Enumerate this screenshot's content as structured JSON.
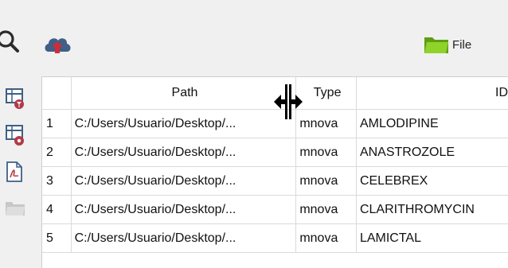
{
  "toolbar": {
    "search_icon": "search-icon",
    "upload_icon": "cloud-upload-icon",
    "file_icon": "folder-icon",
    "file_label": "File"
  },
  "sidebar": {
    "icons": [
      "table-filter-icon",
      "table-settings-icon",
      "pdf-document-icon",
      "folder-icon"
    ]
  },
  "table": {
    "columns": [
      "",
      "Path",
      "Type",
      "ID"
    ],
    "rows": [
      {
        "num": "1",
        "path": "C:/Users/Usuario/Desktop/...",
        "type": "mnova",
        "id": "AMLODIPINE"
      },
      {
        "num": "2",
        "path": "C:/Users/Usuario/Desktop/...",
        "type": "mnova",
        "id": "ANASTROZOLE"
      },
      {
        "num": "3",
        "path": "C:/Users/Usuario/Desktop/...",
        "type": "mnova",
        "id": "CELEBREX"
      },
      {
        "num": "4",
        "path": "C:/Users/Usuario/Desktop/...",
        "type": "mnova",
        "id": "CLARITHROMYCIN"
      },
      {
        "num": "5",
        "path": "C:/Users/Usuario/Desktop/...",
        "type": "mnova",
        "id": "LAMICTAL"
      }
    ]
  },
  "colors": {
    "accent_red": "#b23a48",
    "folder_green": "#7fc31c",
    "cloud_blue": "#3f5f86"
  }
}
